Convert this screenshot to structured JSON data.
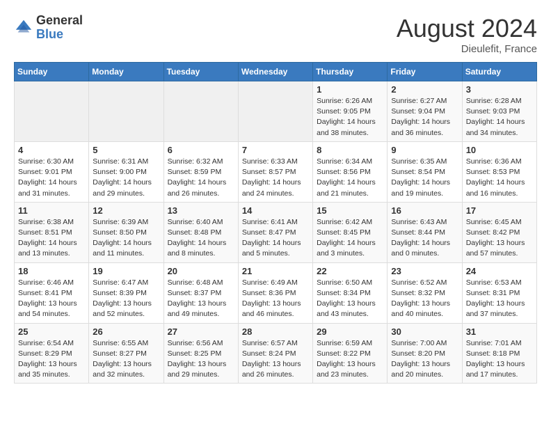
{
  "logo": {
    "general": "General",
    "blue": "Blue"
  },
  "title": "August 2024",
  "subtitle": "Dieulefit, France",
  "days_header": [
    "Sunday",
    "Monday",
    "Tuesday",
    "Wednesday",
    "Thursday",
    "Friday",
    "Saturday"
  ],
  "weeks": [
    [
      {
        "day": "",
        "info": ""
      },
      {
        "day": "",
        "info": ""
      },
      {
        "day": "",
        "info": ""
      },
      {
        "day": "",
        "info": ""
      },
      {
        "day": "1",
        "info": "Sunrise: 6:26 AM\nSunset: 9:05 PM\nDaylight: 14 hours\nand 38 minutes."
      },
      {
        "day": "2",
        "info": "Sunrise: 6:27 AM\nSunset: 9:04 PM\nDaylight: 14 hours\nand 36 minutes."
      },
      {
        "day": "3",
        "info": "Sunrise: 6:28 AM\nSunset: 9:03 PM\nDaylight: 14 hours\nand 34 minutes."
      }
    ],
    [
      {
        "day": "4",
        "info": "Sunrise: 6:30 AM\nSunset: 9:01 PM\nDaylight: 14 hours\nand 31 minutes."
      },
      {
        "day": "5",
        "info": "Sunrise: 6:31 AM\nSunset: 9:00 PM\nDaylight: 14 hours\nand 29 minutes."
      },
      {
        "day": "6",
        "info": "Sunrise: 6:32 AM\nSunset: 8:59 PM\nDaylight: 14 hours\nand 26 minutes."
      },
      {
        "day": "7",
        "info": "Sunrise: 6:33 AM\nSunset: 8:57 PM\nDaylight: 14 hours\nand 24 minutes."
      },
      {
        "day": "8",
        "info": "Sunrise: 6:34 AM\nSunset: 8:56 PM\nDaylight: 14 hours\nand 21 minutes."
      },
      {
        "day": "9",
        "info": "Sunrise: 6:35 AM\nSunset: 8:54 PM\nDaylight: 14 hours\nand 19 minutes."
      },
      {
        "day": "10",
        "info": "Sunrise: 6:36 AM\nSunset: 8:53 PM\nDaylight: 14 hours\nand 16 minutes."
      }
    ],
    [
      {
        "day": "11",
        "info": "Sunrise: 6:38 AM\nSunset: 8:51 PM\nDaylight: 14 hours\nand 13 minutes."
      },
      {
        "day": "12",
        "info": "Sunrise: 6:39 AM\nSunset: 8:50 PM\nDaylight: 14 hours\nand 11 minutes."
      },
      {
        "day": "13",
        "info": "Sunrise: 6:40 AM\nSunset: 8:48 PM\nDaylight: 14 hours\nand 8 minutes."
      },
      {
        "day": "14",
        "info": "Sunrise: 6:41 AM\nSunset: 8:47 PM\nDaylight: 14 hours\nand 5 minutes."
      },
      {
        "day": "15",
        "info": "Sunrise: 6:42 AM\nSunset: 8:45 PM\nDaylight: 14 hours\nand 3 minutes."
      },
      {
        "day": "16",
        "info": "Sunrise: 6:43 AM\nSunset: 8:44 PM\nDaylight: 14 hours\nand 0 minutes."
      },
      {
        "day": "17",
        "info": "Sunrise: 6:45 AM\nSunset: 8:42 PM\nDaylight: 13 hours\nand 57 minutes."
      }
    ],
    [
      {
        "day": "18",
        "info": "Sunrise: 6:46 AM\nSunset: 8:41 PM\nDaylight: 13 hours\nand 54 minutes."
      },
      {
        "day": "19",
        "info": "Sunrise: 6:47 AM\nSunset: 8:39 PM\nDaylight: 13 hours\nand 52 minutes."
      },
      {
        "day": "20",
        "info": "Sunrise: 6:48 AM\nSunset: 8:37 PM\nDaylight: 13 hours\nand 49 minutes."
      },
      {
        "day": "21",
        "info": "Sunrise: 6:49 AM\nSunset: 8:36 PM\nDaylight: 13 hours\nand 46 minutes."
      },
      {
        "day": "22",
        "info": "Sunrise: 6:50 AM\nSunset: 8:34 PM\nDaylight: 13 hours\nand 43 minutes."
      },
      {
        "day": "23",
        "info": "Sunrise: 6:52 AM\nSunset: 8:32 PM\nDaylight: 13 hours\nand 40 minutes."
      },
      {
        "day": "24",
        "info": "Sunrise: 6:53 AM\nSunset: 8:31 PM\nDaylight: 13 hours\nand 37 minutes."
      }
    ],
    [
      {
        "day": "25",
        "info": "Sunrise: 6:54 AM\nSunset: 8:29 PM\nDaylight: 13 hours\nand 35 minutes."
      },
      {
        "day": "26",
        "info": "Sunrise: 6:55 AM\nSunset: 8:27 PM\nDaylight: 13 hours\nand 32 minutes."
      },
      {
        "day": "27",
        "info": "Sunrise: 6:56 AM\nSunset: 8:25 PM\nDaylight: 13 hours\nand 29 minutes."
      },
      {
        "day": "28",
        "info": "Sunrise: 6:57 AM\nSunset: 8:24 PM\nDaylight: 13 hours\nand 26 minutes."
      },
      {
        "day": "29",
        "info": "Sunrise: 6:59 AM\nSunset: 8:22 PM\nDaylight: 13 hours\nand 23 minutes."
      },
      {
        "day": "30",
        "info": "Sunrise: 7:00 AM\nSunset: 8:20 PM\nDaylight: 13 hours\nand 20 minutes."
      },
      {
        "day": "31",
        "info": "Sunrise: 7:01 AM\nSunset: 8:18 PM\nDaylight: 13 hours\nand 17 minutes."
      }
    ]
  ]
}
